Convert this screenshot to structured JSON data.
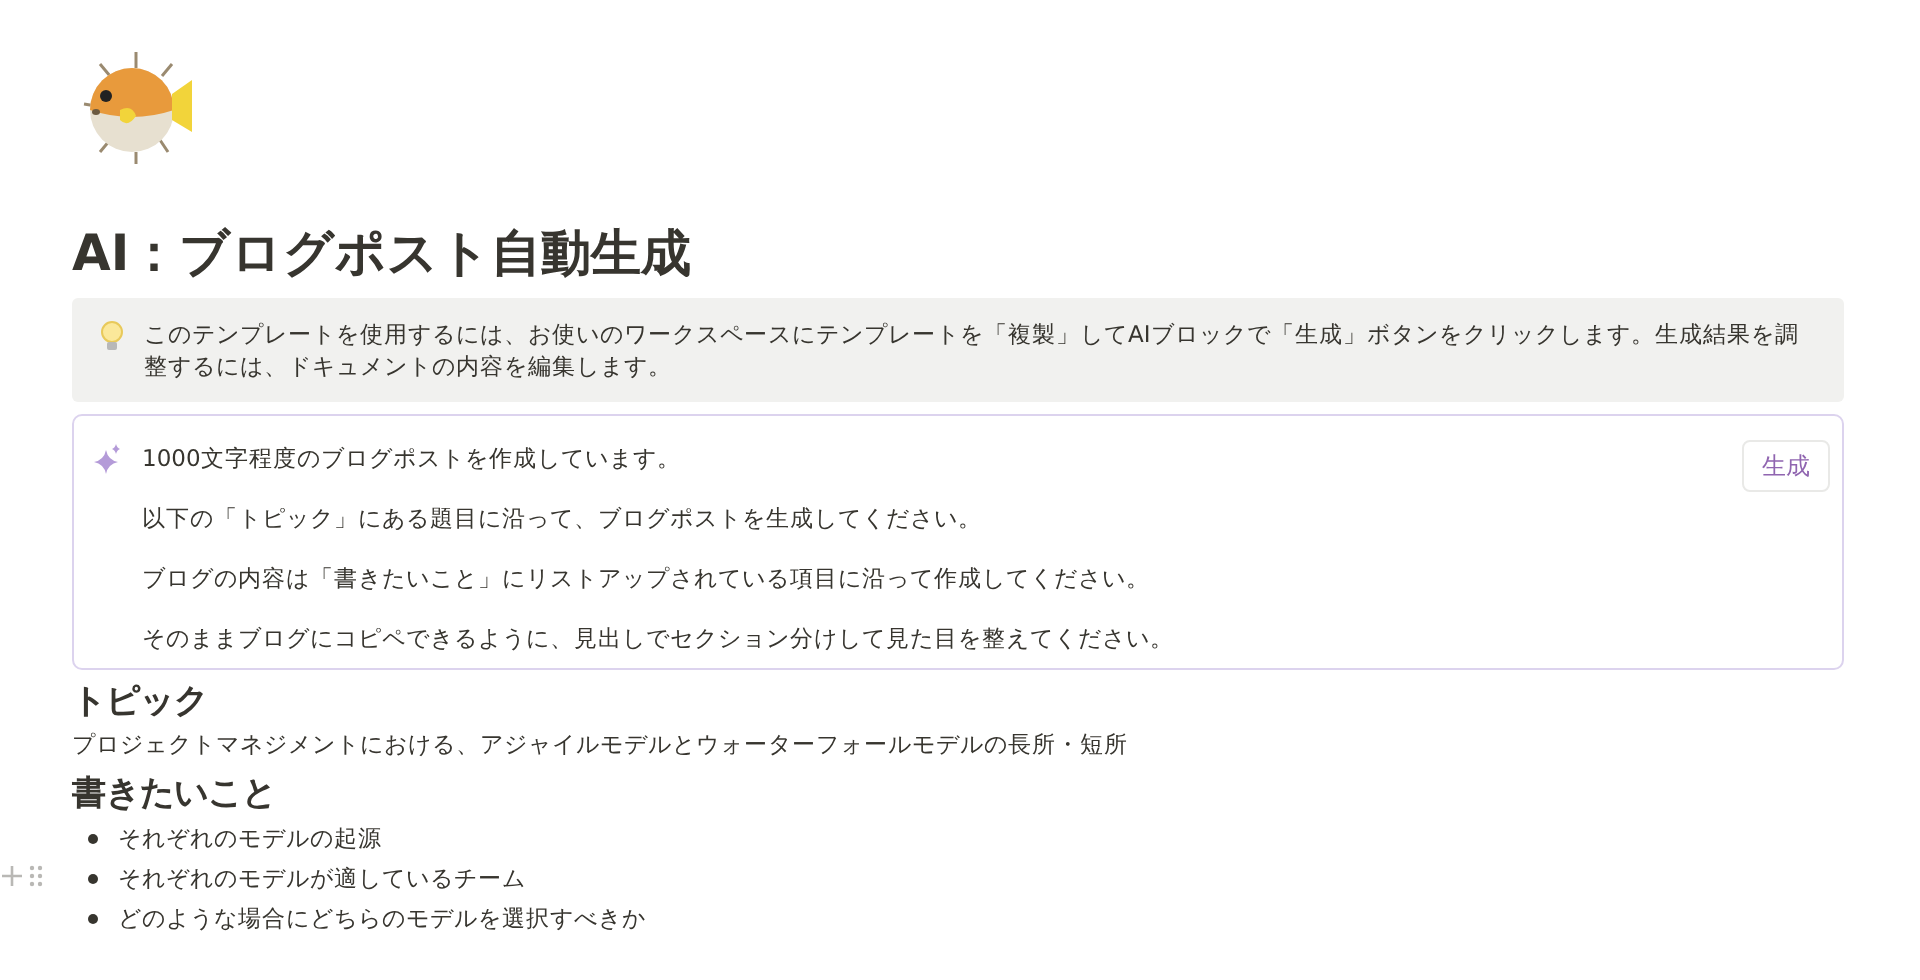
{
  "page": {
    "title": "AI：ブログポスト自動生成"
  },
  "callout": {
    "text": "このテンプレートを使用するには、お使いのワークスペースにテンプレートを「複製」してAIブロックで「生成」ボタンをクリックします。生成結果を調整するには、ドキュメントの内容を編集します。"
  },
  "ai_block": {
    "button": "生成",
    "lines": [
      "1000文字程度のブログポストを作成しています。",
      "以下の「トピック」にある題目に沿って、ブログポストを生成してください。",
      "ブログの内容は「書きたいこと」にリストアップされている項目に沿って作成してください。",
      "そのままブログにコピペできるように、見出しでセクション分けして見た目を整えてください。"
    ]
  },
  "blocks": [
    {
      "kind": "heading",
      "text": "トピック"
    },
    {
      "kind": "paragraph",
      "text": "プロジェクトマネジメントにおける、アジャイルモデルとウォーターフォールモデルの長所・短所"
    },
    {
      "kind": "heading",
      "text": "書きたいこと"
    },
    {
      "kind": "bullet",
      "text": "それぞれのモデルの起源",
      "hovered": false
    },
    {
      "kind": "bullet",
      "text": "それぞれのモデルが適しているチーム",
      "hovered": true
    },
    {
      "kind": "bullet",
      "text": "どのような場合にどちらのモデルを選択すべきか",
      "hovered": false
    }
  ]
}
